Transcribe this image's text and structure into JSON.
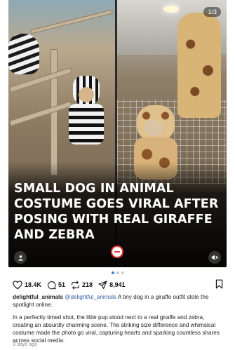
{
  "post": {
    "page_indicator": "1/3",
    "headline": "SMALL DOG IN ANIMAL COSTUME GOES VIRAL AFTER POSING WITH REAL GIRAFFE AND ZEBRA",
    "carousel": {
      "total": 3,
      "active": 1
    }
  },
  "actions": {
    "likes": "18.4K",
    "comments": "51",
    "reposts": "218",
    "shares": "8,941"
  },
  "caption": {
    "username": "delightful_animals",
    "mention": "@delightful_animals",
    "lead": " A tiny dog in a giraffe outfit stole the spotlight online.",
    "body": "In a perfectly timed shot, the little pup stood next to a real giraffe and zebra, creating an absurdly charming scene. The striking size difference and whimsical costume made the photo go viral, capturing hearts and sparking countless shares across social media."
  },
  "timestamp": "3 days ago",
  "icons": {
    "like": "heart-icon",
    "comment": "comment-bubble-icon",
    "repost": "repost-icon",
    "share": "send-icon",
    "save": "bookmark-icon",
    "tagged_user": "user-icon",
    "mute": "speaker-muted-icon"
  },
  "colors": {
    "mention": "#3a5f9f",
    "active_dot": "#2f87f0",
    "brand_red": "#e23a2e"
  }
}
